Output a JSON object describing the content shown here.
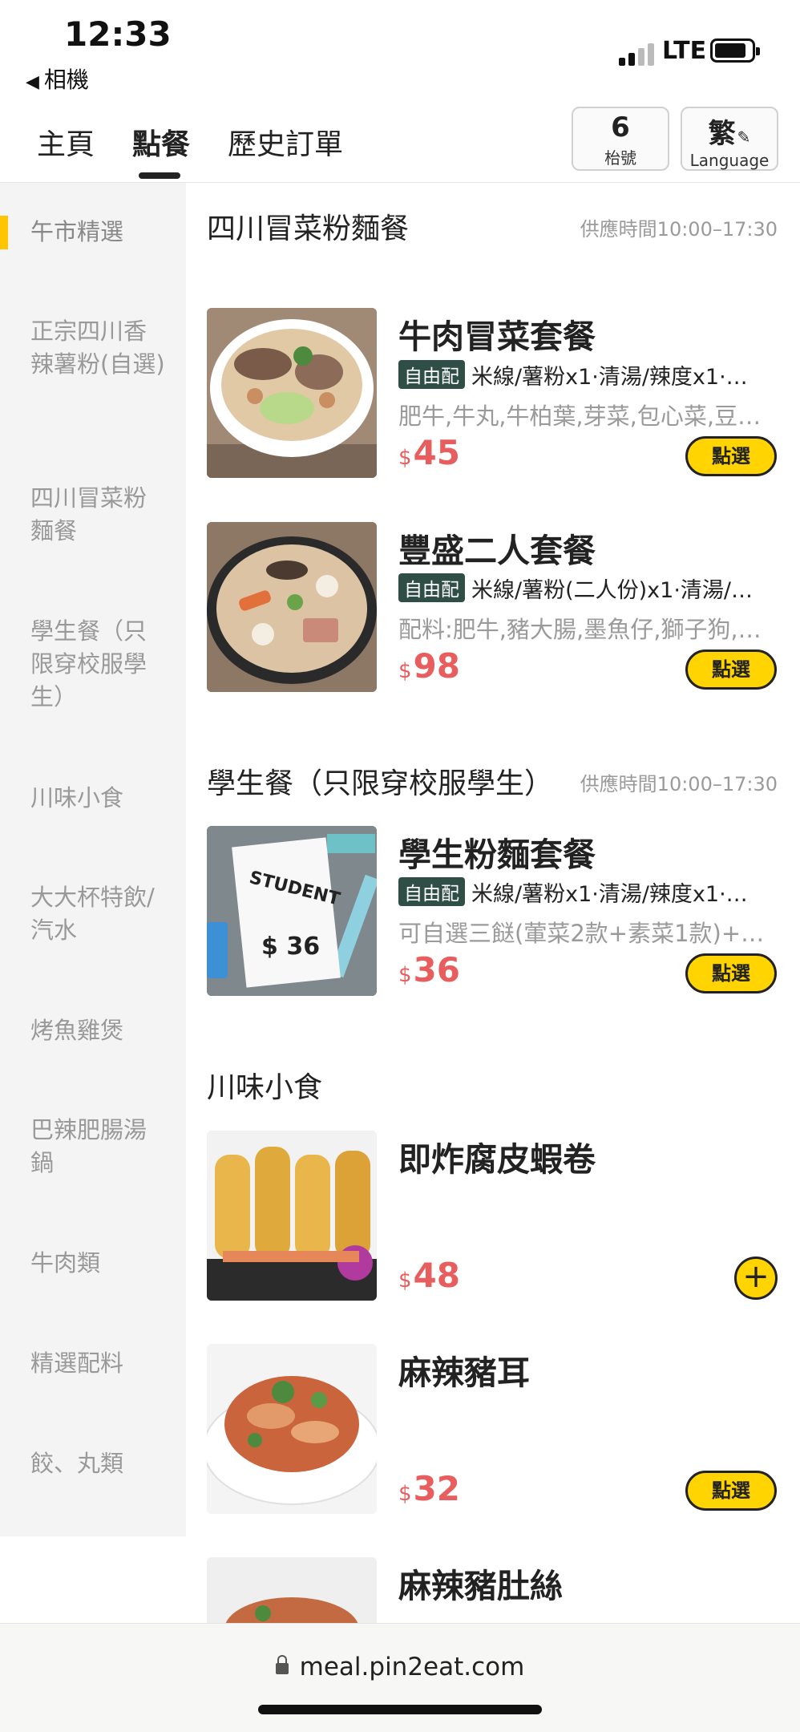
{
  "status": {
    "time": "12:33",
    "back_app": "相機",
    "network": "LTE"
  },
  "nav": {
    "tabs": [
      "主頁",
      "點餐",
      "歷史訂單"
    ],
    "active_tab": "點餐",
    "table_number": "6",
    "table_label": "枱號",
    "language_char": "繁",
    "language_label": "Language"
  },
  "sidebar": {
    "categories": [
      "午市精選",
      "正宗四川香辣薯粉(自選)",
      "四川冒菜粉麵餐",
      "學生餐（只限穿校服學生）",
      "川味小食",
      "大大杯特飲/汽水",
      "烤魚雞煲",
      "巴辣肥腸湯鍋",
      "牛肉類",
      "精選配料",
      "餃、丸類"
    ],
    "active": "午市精選"
  },
  "sections": [
    {
      "title": "四川冒菜粉麵餐",
      "hours": "供應時間10:00–17:30",
      "items": [
        {
          "name": "牛肉冒菜套餐",
          "badge": "自由配",
          "options": "米線/薯粉x1·清湯/辣度x1·…",
          "desc": "肥牛,牛丸,牛柏葉,芽菜,包心菜,豆…",
          "currency": "$",
          "price": "45",
          "button": "點選",
          "image_icon": "beef-noodle-bowl"
        },
        {
          "name": "豐盛二人套餐",
          "badge": "自由配",
          "options": "米線/薯粉(二人份)x1·清湯/…",
          "desc": "配料:肥牛,豬大腸,墨魚仔,獅子狗,…",
          "currency": "$",
          "price": "98",
          "button": "點選",
          "image_icon": "hotpot-bowl"
        }
      ]
    },
    {
      "title": "學生餐（只限穿校服學生）",
      "hours": "供應時間10:00–17:30",
      "items": [
        {
          "name": "學生粉麵套餐",
          "badge": "自由配",
          "options": "米線/薯粉x1·清湯/辣度x1·…",
          "desc": "可自選三餸(葷菜2款+素菜1款)+…",
          "currency": "$",
          "price": "36",
          "button": "點選",
          "image_text_1": "STUDENT",
          "image_text_2": "$ 36"
        }
      ]
    },
    {
      "title": "川味小食",
      "items": [
        {
          "name": "即炸腐皮蝦卷",
          "currency": "$",
          "price": "48",
          "button": "+",
          "image_icon": "fried-shrimp-rolls"
        },
        {
          "name": "麻辣豬耳",
          "currency": "$",
          "price": "32",
          "button": "點選",
          "image_icon": "spicy-pork-ear"
        },
        {
          "name": "麻辣豬肚絲",
          "image_icon": "spicy-pork-tripe"
        }
      ]
    }
  ],
  "urlbar": {
    "url": "meal.pin2eat.com"
  },
  "colors": {
    "accent_yellow": "#ffd400",
    "price_red": "#e85d5d",
    "badge_green": "#2f4f46",
    "sidebar_bg": "#f4f4f4"
  }
}
